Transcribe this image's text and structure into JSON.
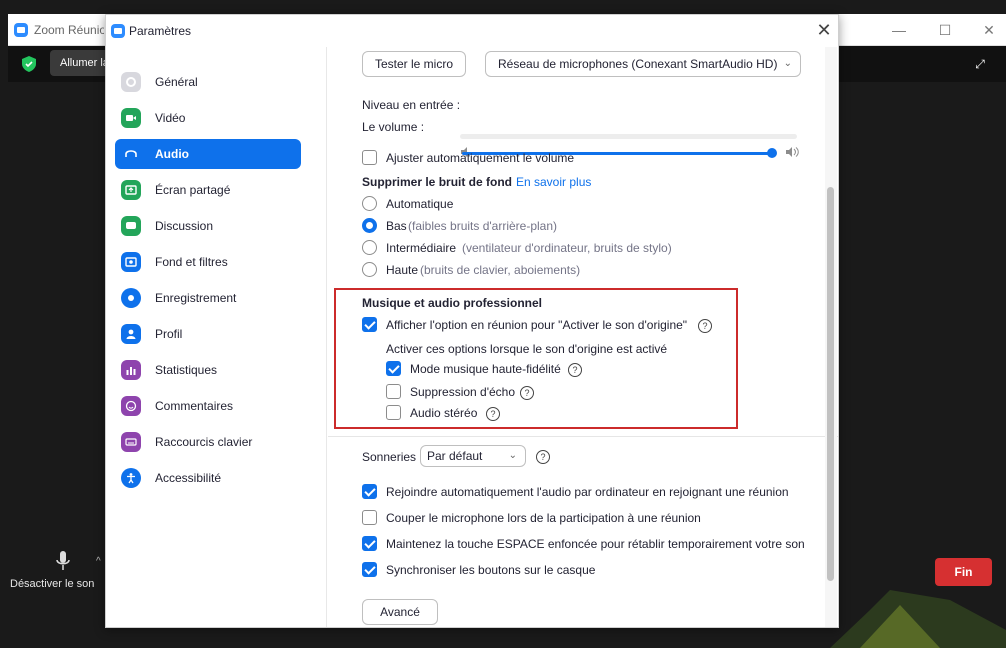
{
  "meeting": {
    "title": "Zoom Réunion",
    "allumer_label": "Allumer la vidéo",
    "mute_label": "Désactiver le son",
    "end_label": "Fin"
  },
  "settings": {
    "title": "Paramètres",
    "close_glyph": "✕",
    "sidebar": [
      {
        "label": "Général",
        "icon": "gear-icon",
        "color": "#8c8c9a",
        "active": false
      },
      {
        "label": "Vidéo",
        "icon": "video-icon",
        "color": "#23a55a",
        "active": false
      },
      {
        "label": "Audio",
        "icon": "headphones-icon",
        "color": "#ffffff",
        "active": true
      },
      {
        "label": "Écran partagé",
        "icon": "share-screen-icon",
        "color": "#23a55a",
        "active": false
      },
      {
        "label": "Discussion",
        "icon": "chat-icon",
        "color": "#23a55a",
        "active": false
      },
      {
        "label": "Fond et filtres",
        "icon": "background-icon",
        "color": "#0e71eb",
        "active": false
      },
      {
        "label": "Enregistrement",
        "icon": "record-icon",
        "color": "#0e71eb",
        "active": false
      },
      {
        "label": "Profil",
        "icon": "profile-icon",
        "color": "#0e71eb",
        "active": false
      },
      {
        "label": "Statistiques",
        "icon": "stats-icon",
        "color": "#8e44ad",
        "active": false
      },
      {
        "label": "Commentaires",
        "icon": "feedback-icon",
        "color": "#8e44ad",
        "active": false
      },
      {
        "label": "Raccourcis clavier",
        "icon": "keyboard-icon",
        "color": "#8e44ad",
        "active": false
      },
      {
        "label": "Accessibilité",
        "icon": "accessibility-icon",
        "color": "#0e71eb",
        "active": false
      }
    ],
    "audio": {
      "test_mic_label": "Tester le micro",
      "mic_device": "Réseau de microphones (Conexant SmartAudio HD)",
      "input_level_label": "Niveau en entrée :",
      "volume_label": "Le volume :",
      "volume_level": 1.0,
      "auto_volume": {
        "label": "Ajuster automatiquement le volume",
        "checked": false
      },
      "noise_title": "Supprimer le bruit de fond",
      "noise_link": "En savoir plus",
      "noise_options": [
        {
          "label": "Automatique",
          "hint": "",
          "checked": false
        },
        {
          "label": "Bas",
          "hint": "(faibles bruits d'arrière-plan)",
          "checked": true
        },
        {
          "label": "Intermédiaire",
          "hint": "(ventilateur d'ordinateur, bruits de stylo)",
          "checked": false
        },
        {
          "label": "Haute",
          "hint": "(bruits de clavier, aboiements)",
          "checked": false
        }
      ],
      "music_title": "Musique et audio professionnel",
      "original_sound": {
        "label": "Afficher l'option en réunion pour \"Activer le son d'origine\"",
        "checked": true
      },
      "activate_note": "Activer ces options lorsque le son d'origine est activé",
      "music_options": [
        {
          "label": "Mode musique haute-fidélité",
          "checked": true
        },
        {
          "label": "Suppression d'écho",
          "checked": false
        },
        {
          "label": "Audio stéréo",
          "checked": false
        }
      ],
      "ringtones_label": "Sonneries",
      "ringtone_value": "Par défaut",
      "bottom_options": [
        {
          "label": "Rejoindre automatiquement l'audio par ordinateur en rejoignant une réunion",
          "checked": true
        },
        {
          "label": "Couper le microphone lors de la participation à une réunion",
          "checked": false
        },
        {
          "label": "Maintenez la touche ESPACE enfoncée pour rétablir temporairement votre son",
          "checked": true
        },
        {
          "label": "Synchroniser les boutons sur le casque",
          "checked": true
        }
      ],
      "advanced_label": "Avancé",
      "help_glyph": "?"
    }
  }
}
